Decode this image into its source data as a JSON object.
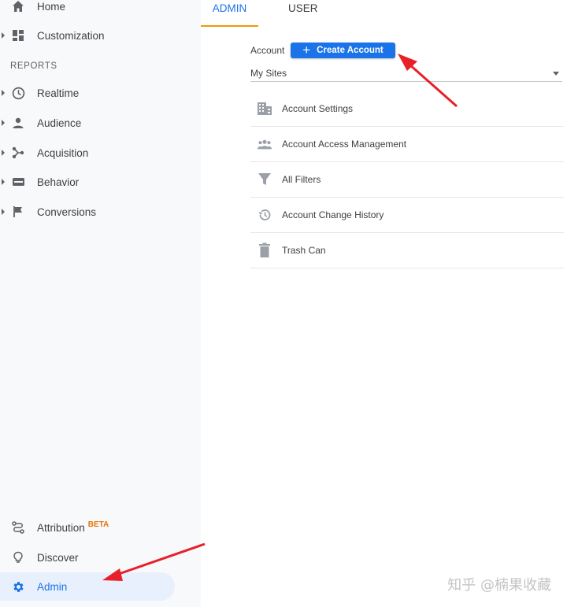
{
  "sidebar": {
    "top_items": [
      {
        "label": "Home",
        "icon": "home-icon"
      },
      {
        "label": "Customization",
        "icon": "dashboard-icon"
      }
    ],
    "section_label": "REPORTS",
    "report_items": [
      {
        "label": "Realtime",
        "icon": "clock-icon"
      },
      {
        "label": "Audience",
        "icon": "person-icon"
      },
      {
        "label": "Acquisition",
        "icon": "acquisition-icon"
      },
      {
        "label": "Behavior",
        "icon": "behavior-icon"
      },
      {
        "label": "Conversions",
        "icon": "flag-icon"
      }
    ],
    "bottom_items": [
      {
        "label": "Attribution",
        "badge": "BETA",
        "icon": "attribution-icon"
      },
      {
        "label": "Discover",
        "icon": "lightbulb-icon"
      },
      {
        "label": "Admin",
        "icon": "gear-icon"
      }
    ]
  },
  "tabs": [
    {
      "label": "ADMIN",
      "active": true
    },
    {
      "label": "USER",
      "active": false
    }
  ],
  "account": {
    "label": "Account",
    "create_button": "Create Account",
    "selected_site": "My Sites"
  },
  "menu": [
    {
      "label": "Account Settings",
      "icon": "building-icon"
    },
    {
      "label": "Account Access Management",
      "icon": "people-icon"
    },
    {
      "label": "All Filters",
      "icon": "filter-icon"
    },
    {
      "label": "Account Change History",
      "icon": "history-icon"
    },
    {
      "label": "Trash Can",
      "icon": "trash-icon"
    }
  ],
  "watermark": "知乎 @楠果收藏",
  "colors": {
    "accent": "#1a73e8",
    "tab_underline": "#f29900",
    "beta": "#e8710a",
    "annotation_arrow": "#e8202a",
    "sidebar_bg": "#f8f9fa"
  }
}
